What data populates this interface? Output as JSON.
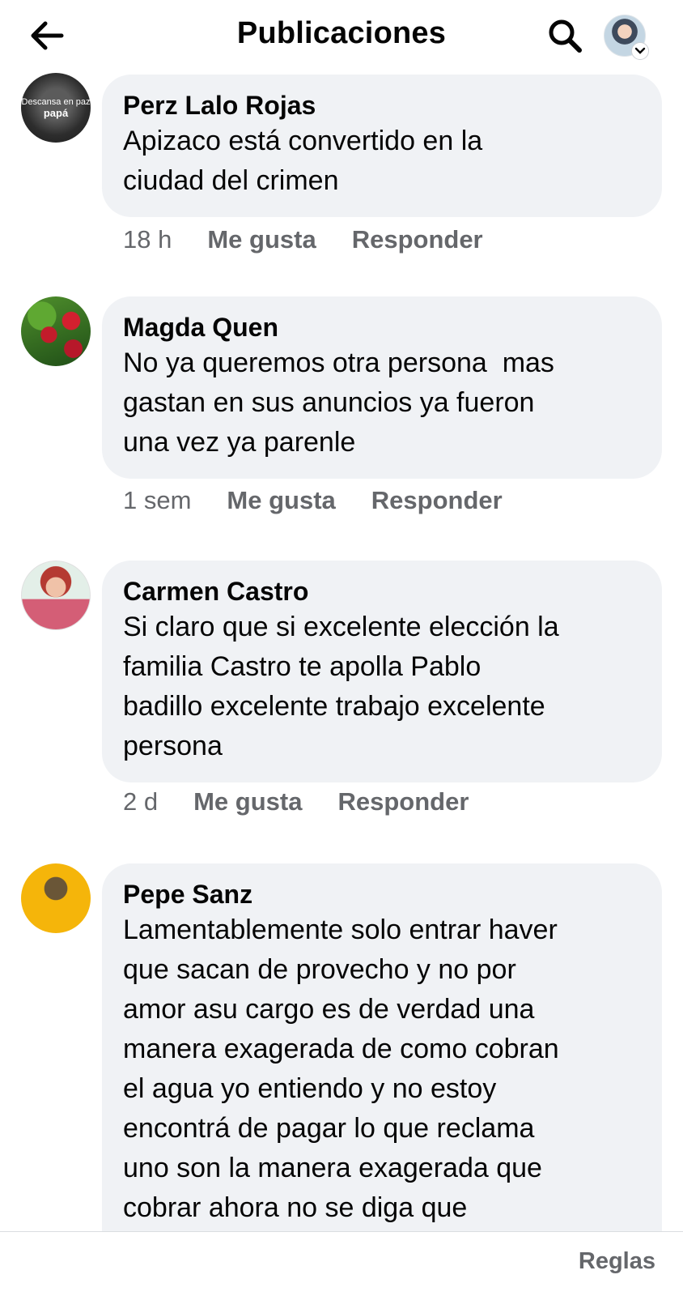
{
  "header": {
    "title": "Publicaciones",
    "back_icon": "back-arrow-icon",
    "search_icon": "search-icon"
  },
  "comments": [
    {
      "author": "Perz Lalo Rojas",
      "text": "Apizaco está convertido en la\nciudad del crimen",
      "time": "18 h",
      "like": "Me gusta",
      "reply": "Responder",
      "avatar_text_top": "Descansa en paz",
      "avatar_text_main": "papá"
    },
    {
      "author": "Magda Quen",
      "text": "No ya queremos otra persona  mas\ngastan en sus anuncios ya fueron\nuna vez ya parenle",
      "time": "1 sem",
      "like": "Me gusta",
      "reply": "Responder"
    },
    {
      "author": "Carmen Castro",
      "text": "Si claro que si excelente elección la\nfamilia Castro te apolla Pablo\nbadillo excelente trabajo excelente\npersona",
      "time": "2 d",
      "like": "Me gusta",
      "reply": "Responder"
    },
    {
      "author": "Pepe Sanz",
      "text": "Lamentablemente solo entrar haver\nque sacan de provecho y no por\namor asu cargo es de verdad una\nmanera exagerada de como cobran\nel agua yo entiendo y no estoy\nencontrá de pagar lo que reclama\nuno son la manera exagerada que\ncobrar ahora no se diga que"
    }
  ],
  "footer": {
    "rules": "Reglas"
  }
}
